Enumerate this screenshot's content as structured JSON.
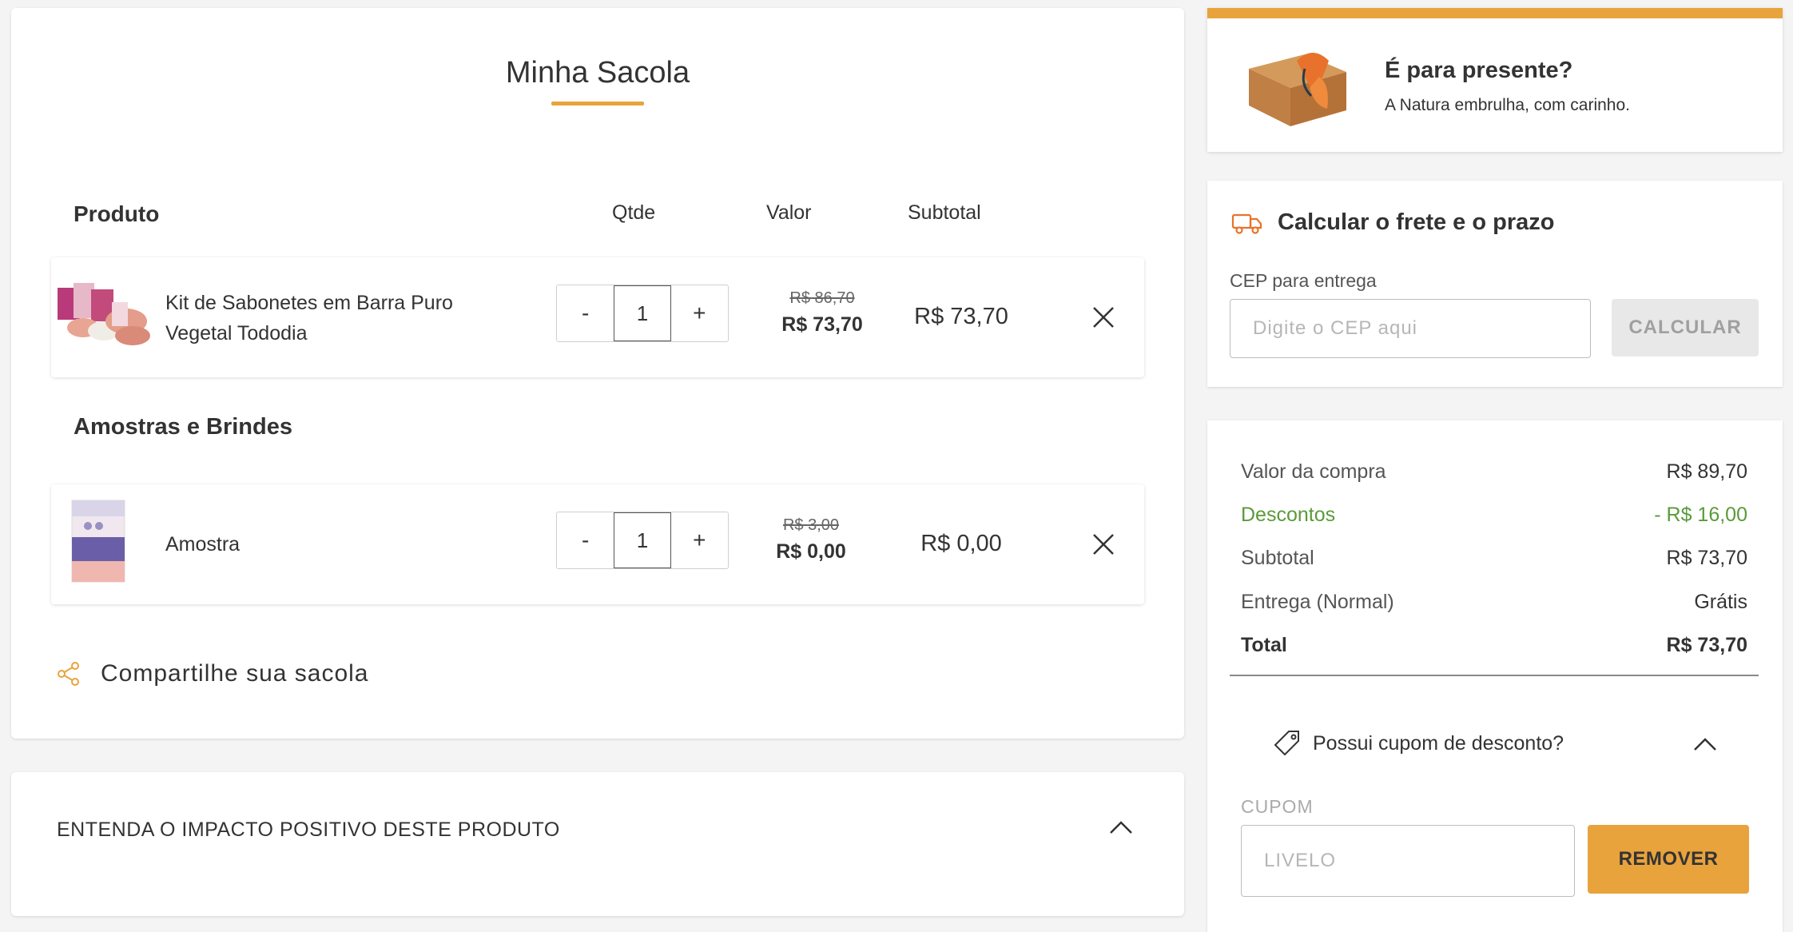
{
  "cart": {
    "title": "Minha Sacola",
    "columns": {
      "product": "Produto",
      "qty": "Qtde",
      "value": "Valor",
      "subtotal": "Subtotal"
    },
    "items": [
      {
        "name": "Kit de Sabonetes em Barra Puro Vegetal Tododia",
        "qty": "1",
        "old_price": "R$ 86,70",
        "price": "R$ 73,70",
        "subtotal": "R$ 73,70",
        "minus": "-",
        "plus": "+"
      },
      {
        "name": "Amostra",
        "qty": "1",
        "old_price": "R$ 3,00",
        "price": "R$ 0,00",
        "subtotal": "R$ 0,00",
        "minus": "-",
        "plus": "+"
      }
    ],
    "samples_heading": "Amostras e Brindes",
    "share_label": "Compartilhe sua sacola"
  },
  "impact": {
    "title": "ENTENDA O IMPACTO POSITIVO DESTE PRODUTO"
  },
  "gift": {
    "title": "É para presente?",
    "subtitle": "A Natura embrulha, com carinho."
  },
  "shipping": {
    "title": "Calcular o frete e o prazo",
    "cep_label": "CEP para entrega",
    "cep_placeholder": "Digite o CEP aqui",
    "button": "CALCULAR"
  },
  "summary": {
    "rows": [
      {
        "label": "Valor da compra",
        "value": "R$ 89,70"
      },
      {
        "label": "Descontos",
        "value": "- R$ 16,00"
      },
      {
        "label": "Subtotal",
        "value": "R$ 73,70"
      },
      {
        "label": "Entrega (Normal)",
        "value": "Grátis"
      },
      {
        "label": "Total",
        "value": "R$ 73,70"
      }
    ],
    "coupon_toggle": "Possui cupom de desconto?",
    "coupon_label": "CUPOM",
    "coupon_placeholder": "LIVELO",
    "remove_button": "REMOVER"
  },
  "colors": {
    "accent": "#e8a33d",
    "discount": "#5a9a3a"
  },
  "icons": [
    "close-icon",
    "share-icon",
    "truck-icon",
    "tag-icon",
    "chevron-up-icon"
  ]
}
